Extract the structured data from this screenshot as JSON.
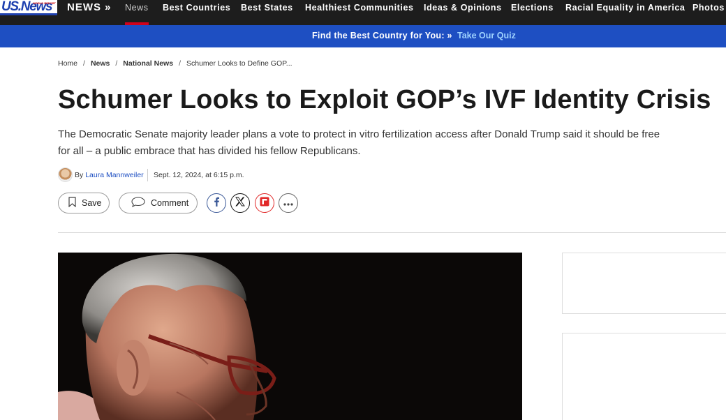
{
  "topnav": {
    "logo_text": "US.News",
    "logo_small": "WORLD REPORT",
    "section_label": "NEWS »",
    "items": [
      {
        "label": "News",
        "active": true
      },
      {
        "label": "Best Countries"
      },
      {
        "label": "Best States"
      },
      {
        "label": "Healthiest Communities"
      },
      {
        "label": "Ideas & Opinions"
      },
      {
        "label": "Elections"
      },
      {
        "label": "Racial Equality in America"
      },
      {
        "label": "Photos"
      }
    ]
  },
  "banner": {
    "text": "Find the Best Country for You: »",
    "link": "Take Our Quiz",
    "color": "#1e4fc2"
  },
  "breadcrumb": [
    "Home",
    "News",
    "National News",
    "Schumer Looks to Define GOP..."
  ],
  "article": {
    "headline": "Schumer Looks to Exploit GOP’s IVF Identity Crisis",
    "dek": "The Democratic Senate majority leader plans a vote to protect in vitro fertilization access after Donald Trump said it should be free for all – a public embrace that has divided his fellow Republicans.",
    "by_prefix": "By",
    "author": "Laura Mannweiler",
    "date": "Sept. 12, 2024, at 6:15 p.m."
  },
  "actions": {
    "save_label": "Save",
    "comment_label": "Comment",
    "share_icons": [
      "facebook-icon",
      "x-icon",
      "flipboard-icon",
      "more-icon"
    ]
  }
}
